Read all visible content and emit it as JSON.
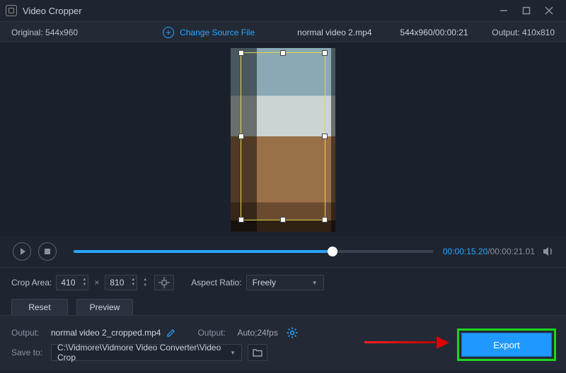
{
  "app": {
    "title": "Video Cropper"
  },
  "infobar": {
    "original_label": "Original:",
    "original_dims": "544x960",
    "change_source_label": "Change Source File",
    "filename": "normal video 2.mp4",
    "dims_time": "544x960/00:00:21",
    "output_label": "Output:",
    "output_dims": "410x810"
  },
  "player": {
    "time_current": "00:00:15.20",
    "time_total": "00:00:21.01"
  },
  "crop": {
    "area_label": "Crop Area:",
    "width": "410",
    "height": "810",
    "aspect_label": "Aspect Ratio:",
    "aspect_value": "Freely",
    "reset_label": "Reset",
    "preview_label": "Preview"
  },
  "output": {
    "label": "Output:",
    "filename": "normal video 2_cropped.mp4",
    "format_label": "Output:",
    "format_value": "Auto;24fps",
    "save_label": "Save to:",
    "save_path": "C:\\Vidmore\\Vidmore Video Converter\\Video Crop",
    "export_label": "Export"
  }
}
